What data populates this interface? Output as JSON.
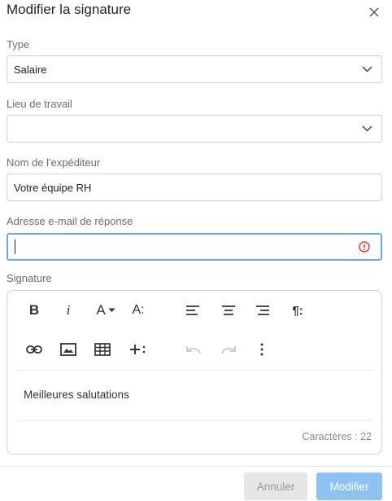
{
  "dialog": {
    "title": "Modifier la signature"
  },
  "form": {
    "type": {
      "label": "Type",
      "value": "Salaire"
    },
    "workplace": {
      "label": "Lieu de travail",
      "value": ""
    },
    "sender_name": {
      "label": "Nom de l'expéditeur",
      "value": "Votre équipe RH"
    },
    "reply_email": {
      "label": "Adresse e-mail de réponse",
      "value": "",
      "status": "error"
    }
  },
  "editor": {
    "label": "Signature",
    "toolbar": {
      "bold": "B",
      "italic": "i",
      "font_color": "A",
      "font_size": "A:",
      "paragraph": "¶:"
    },
    "content": "Meilleures salutations",
    "char_count": "Caractères : 22"
  },
  "footer": {
    "cancel_label": "Annuler",
    "submit_label": "Modifier"
  },
  "colors": {
    "accent": "#8ec2f0",
    "focus_border": "#6aa9e6",
    "error": "#e53935"
  }
}
